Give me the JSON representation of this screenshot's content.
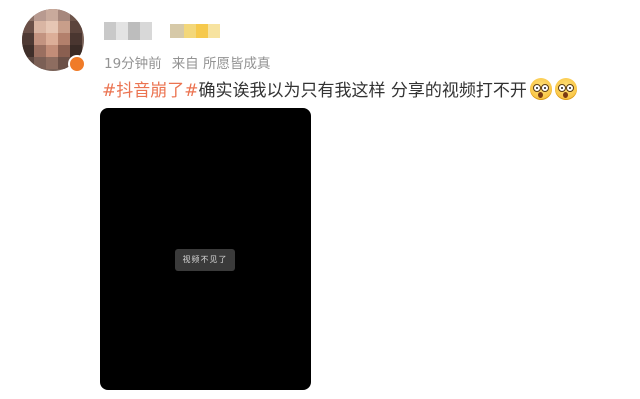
{
  "post": {
    "timestamp": "19分钟前",
    "source": "来自 所愿皆成真",
    "topic": "#抖音崩了#",
    "text": "确实诶我以为只有我这样 分享的视频打不开",
    "emoji": [
      "astonished-face-emoji",
      "astonished-face-emoji"
    ]
  },
  "video": {
    "toast_text": "视频不见了"
  },
  "colors": {
    "topic": "#eb7350",
    "meta": "#939393",
    "body_text": "#333333",
    "video_bg": "#000000"
  }
}
